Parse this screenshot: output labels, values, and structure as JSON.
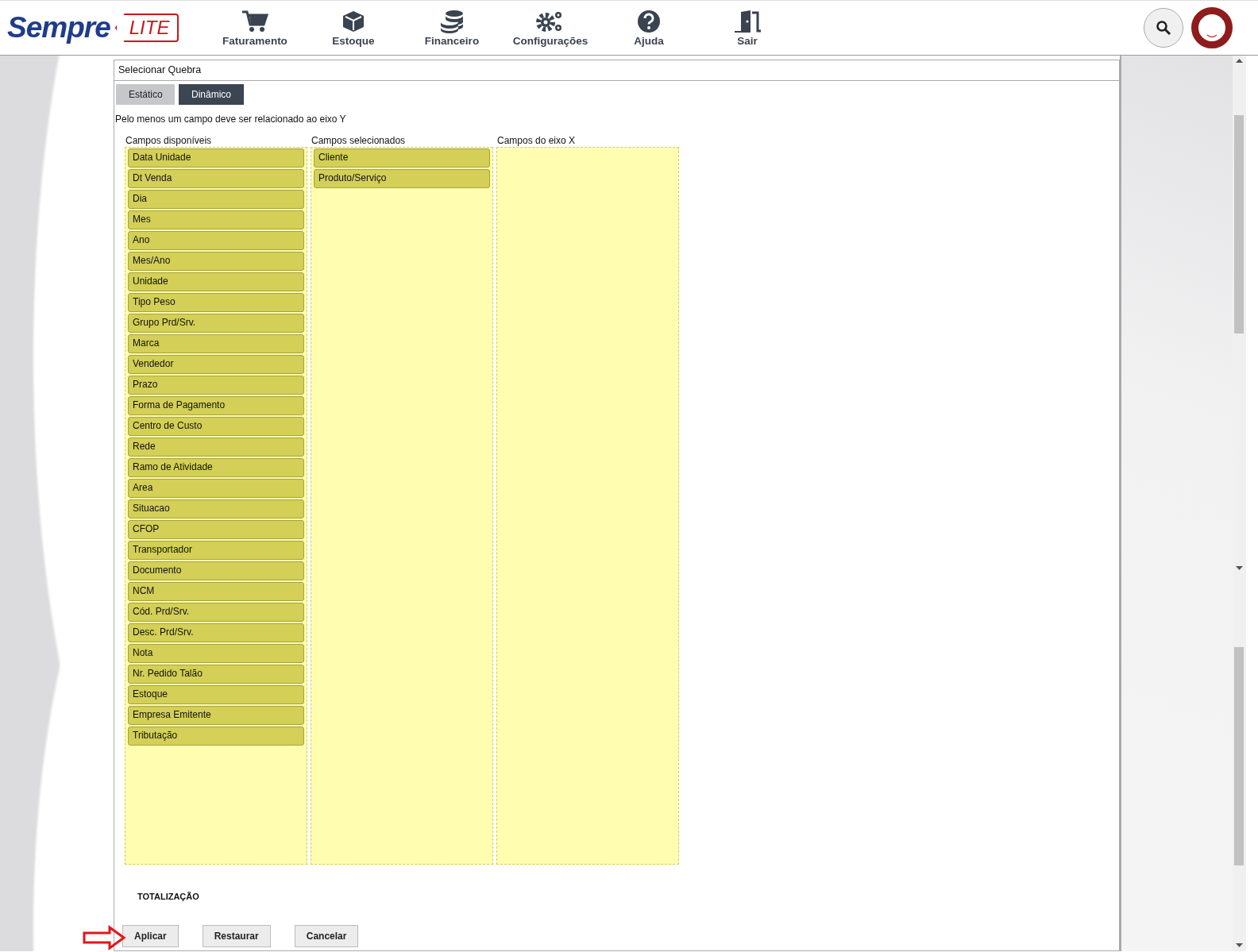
{
  "header": {
    "logo": {
      "name": "Sempre",
      "badge": "LITE"
    },
    "nav": [
      {
        "label": "Faturamento",
        "kind": "cart"
      },
      {
        "label": "Estoque",
        "kind": "box"
      },
      {
        "label": "Financeiro",
        "kind": "coins"
      },
      {
        "label": "Configurações",
        "kind": "gears"
      },
      {
        "label": "Ajuda",
        "kind": "help"
      },
      {
        "label": "Sair",
        "kind": "exit"
      }
    ]
  },
  "dialog": {
    "title": "Selecionar Quebra",
    "tabs": [
      {
        "label": "Estático",
        "selected": false
      },
      {
        "label": "Dinâmico",
        "selected": true
      }
    ],
    "hint": "Pelo menos um campo deve ser relacionado ao eixo Y",
    "columns": [
      {
        "title": "Campos disponíveis",
        "items": [
          "Data Unidade",
          "Dt Venda",
          "Dia",
          "Mes",
          "Ano",
          "Mes/Ano",
          "Unidade",
          "Tipo Peso",
          "Grupo Prd/Srv.",
          "Marca",
          "Vendedor",
          "Prazo",
          "Forma de Pagamento",
          "Centro de Custo",
          "Rede",
          "Ramo de Atividade",
          "Area",
          "Situacao",
          "CFOP",
          "Transportador",
          "Documento",
          "NCM",
          "Cód. Prd/Srv.",
          "Desc. Prd/Srv.",
          "Nota",
          "Nr. Pedido Talão",
          "Estoque",
          "Empresa Emitente",
          "Tributação"
        ]
      },
      {
        "title": "Campos selecionados",
        "items": [
          "Cliente",
          "Produto/Serviço"
        ]
      },
      {
        "title": "Campos do eixo X"
      }
    ],
    "totals_label": "TOTALIZAÇÃO",
    "buttons": [
      "Aplicar",
      "Restaurar",
      "Cancelar"
    ]
  }
}
